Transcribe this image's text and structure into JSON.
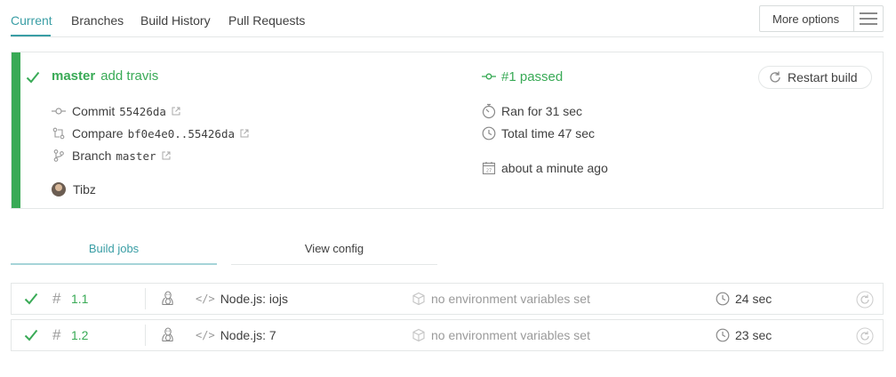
{
  "tabs": [
    {
      "label": "Current",
      "active": true
    },
    {
      "label": "Branches",
      "active": false
    },
    {
      "label": "Build History",
      "active": false
    },
    {
      "label": "Pull Requests",
      "active": false
    }
  ],
  "more_options": {
    "label": "More options"
  },
  "build": {
    "status_color": "#39aa56",
    "branch": "master",
    "message": "add travis",
    "commit_label": "Commit",
    "commit_sha": "55426da",
    "compare_label": "Compare",
    "compare_range": "bf0e4e0..55426da",
    "branch_label": "Branch",
    "branch_name": "master",
    "author": "Tibz",
    "number_status": "#1 passed",
    "ran_for": "Ran for 31 sec",
    "total_time": "Total time 47 sec",
    "finished": "about a minute ago",
    "restart_label": "Restart build"
  },
  "subtabs": [
    {
      "label": "Build jobs",
      "active": true
    },
    {
      "label": "View config",
      "active": false
    }
  ],
  "jobs": [
    {
      "number": "1.1",
      "language": "Node.js: iojs",
      "env": "no environment variables set",
      "duration": "24 sec"
    },
    {
      "number": "1.2",
      "language": "Node.js: 7",
      "env": "no environment variables set",
      "duration": "23 sec"
    }
  ],
  "icons": {
    "status": "check-icon",
    "commit": "commit-icon",
    "compare": "compare-icon",
    "branch": "branch-icon",
    "build_number": "build-icon",
    "ran_for": "stopwatch-icon",
    "total_time": "clock-icon",
    "finished": "calendar-icon",
    "restart": "restart-icon",
    "os": "linux-icon",
    "language": "code-icon",
    "env": "cube-icon"
  }
}
